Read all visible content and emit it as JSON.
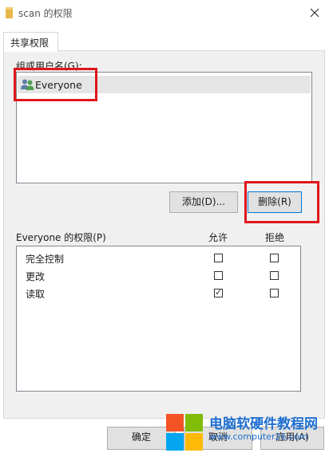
{
  "window": {
    "title": "scan 的权限",
    "close_glyph": "✕"
  },
  "tabs": [
    {
      "label": "共享权限",
      "active": true
    }
  ],
  "group_list": {
    "label": "组或用户名(G):",
    "items": [
      {
        "name": "Everyone",
        "icon": "users-icon",
        "selected": true
      }
    ]
  },
  "buttons": {
    "add": "添加(D)...",
    "remove": "删除(R)",
    "ok": "确定",
    "cancel": "取消",
    "apply": "应用(A)"
  },
  "permissions": {
    "title": "Everyone 的权限(P)",
    "allow_header": "允许",
    "deny_header": "拒绝",
    "rows": [
      {
        "name": "完全控制",
        "allow": false,
        "deny": false
      },
      {
        "name": "更改",
        "allow": false,
        "deny": false
      },
      {
        "name": "读取",
        "allow": true,
        "deny": false
      }
    ]
  },
  "watermark": {
    "title": "电脑软硬件教程网",
    "url": "www.computer26.com"
  },
  "colors": {
    "highlight_box": "#e0161c",
    "focus_border": "#0078d7",
    "selection": "#e5e5e5"
  }
}
